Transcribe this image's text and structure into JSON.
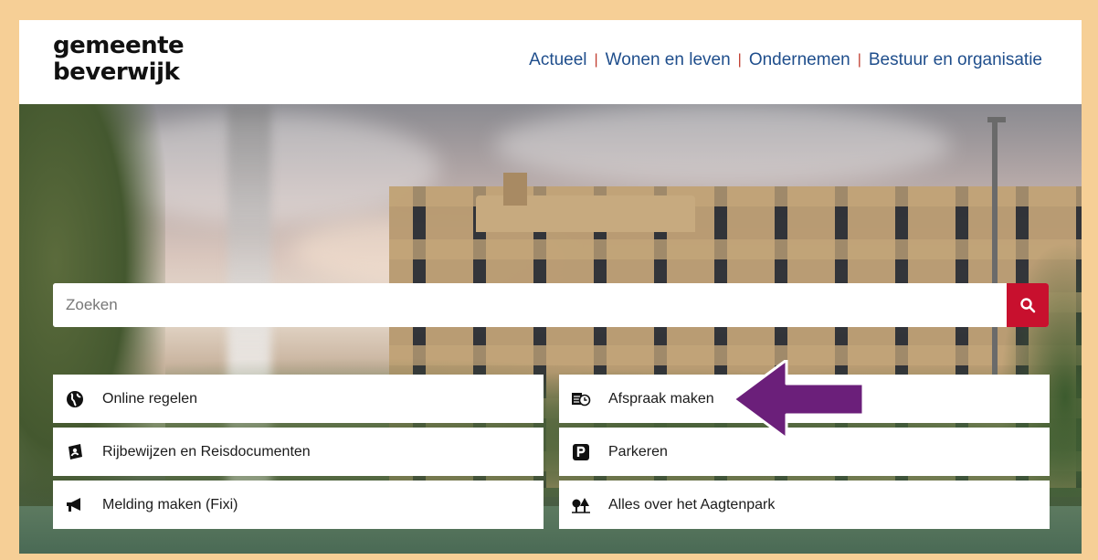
{
  "header": {
    "logo_line1": "gemeente",
    "logo_line2": "beverwijk",
    "nav": [
      {
        "label": "Actueel"
      },
      {
        "label": "Wonen en leven"
      },
      {
        "label": "Ondernemen"
      },
      {
        "label": "Bestuur en organisatie"
      }
    ]
  },
  "search": {
    "placeholder": "Zoeken",
    "button_icon": "search-icon"
  },
  "tiles": [
    {
      "label": "Online regelen",
      "icon": "globe-icon"
    },
    {
      "label": "Afspraak maken",
      "icon": "calendar-clock-icon"
    },
    {
      "label": "Rijbewijzen en Reisdocumenten",
      "icon": "id-card-icon"
    },
    {
      "label": "Parkeren",
      "icon": "parking-icon"
    },
    {
      "label": "Melding maken (Fixi)",
      "icon": "megaphone-icon"
    },
    {
      "label": "Alles over het Aagtenpark",
      "icon": "park-icon"
    }
  ],
  "colors": {
    "nav_link": "#1f4e8c",
    "nav_separator": "#c0392b",
    "search_button": "#c8102e",
    "annotation_arrow": "#6b1f7a",
    "frame_border": "#f6cf96"
  }
}
